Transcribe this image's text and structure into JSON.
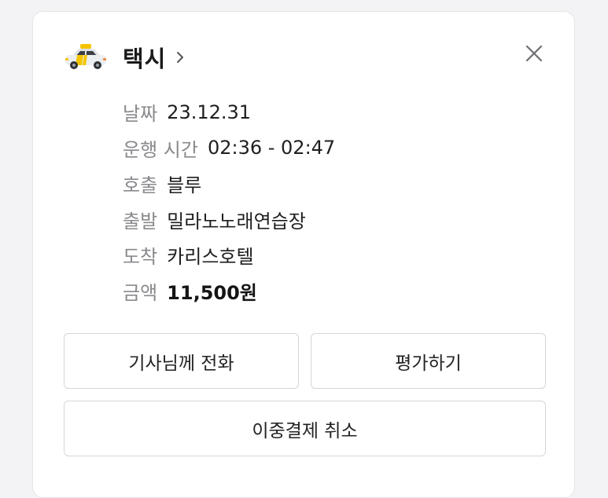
{
  "header": {
    "title": "택시",
    "icon": "taxi-icon",
    "chevron_icon": "chevron-right-icon",
    "close_icon": "close-icon"
  },
  "details": [
    {
      "label": "날짜",
      "value": "23.12.31"
    },
    {
      "label": "운행 시간",
      "value": "02:36 - 02:47"
    },
    {
      "label": "호출",
      "value": "블루"
    },
    {
      "label": "출발",
      "value": "밀라노노래연습장"
    },
    {
      "label": "도착",
      "value": "카리스호텔"
    },
    {
      "label": "금액",
      "value": "11,500원"
    }
  ],
  "actions": {
    "call_driver": "기사님께 전화",
    "rate": "평가하기",
    "cancel_double_payment": "이중결제 취소"
  },
  "colors": {
    "taxi_body": "#eceff2",
    "taxi_accent": "#f5c400",
    "label_gray": "#8a8a8e"
  }
}
